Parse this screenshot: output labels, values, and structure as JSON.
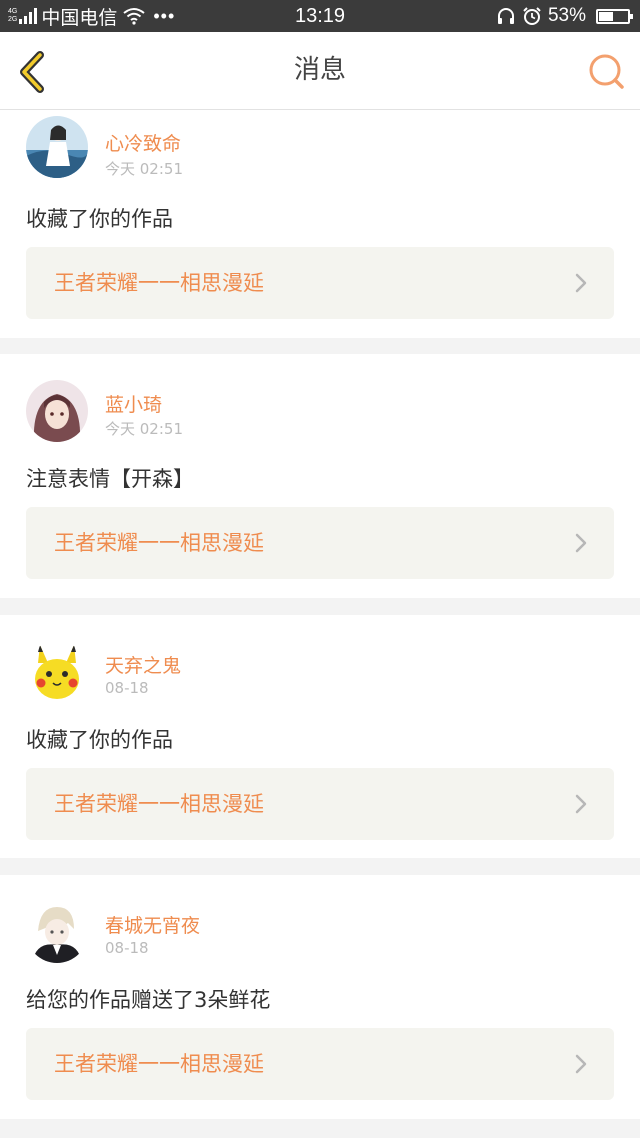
{
  "statusbar": {
    "network_top": "4G",
    "network_bottom": "2G",
    "carrier": "中国电信",
    "more": "•••",
    "time": "13:19",
    "battery_percent": "53%",
    "battery_level": 0.53
  },
  "nav": {
    "title": "消息",
    "accent_color": "#ef8c4f",
    "back_icon": "chevron-left-icon",
    "search_icon": "search-icon"
  },
  "messages": [
    {
      "user": "心冷致命",
      "time": "今天 02:51",
      "text": "收藏了你的作品",
      "work": "王者荣耀一一相思漫延"
    },
    {
      "user": "蓝小琦",
      "time": "今天 02:51",
      "text": "注意表情【开森】",
      "work": "王者荣耀一一相思漫延"
    },
    {
      "user": "天弃之鬼",
      "time": "08-18",
      "text": "收藏了你的作品",
      "work": "王者荣耀一一相思漫延"
    },
    {
      "user": "春城无宵夜",
      "time": "08-18",
      "text": "给您的作品赠送了3朵鲜花",
      "work": "王者荣耀一一相思漫延"
    }
  ]
}
